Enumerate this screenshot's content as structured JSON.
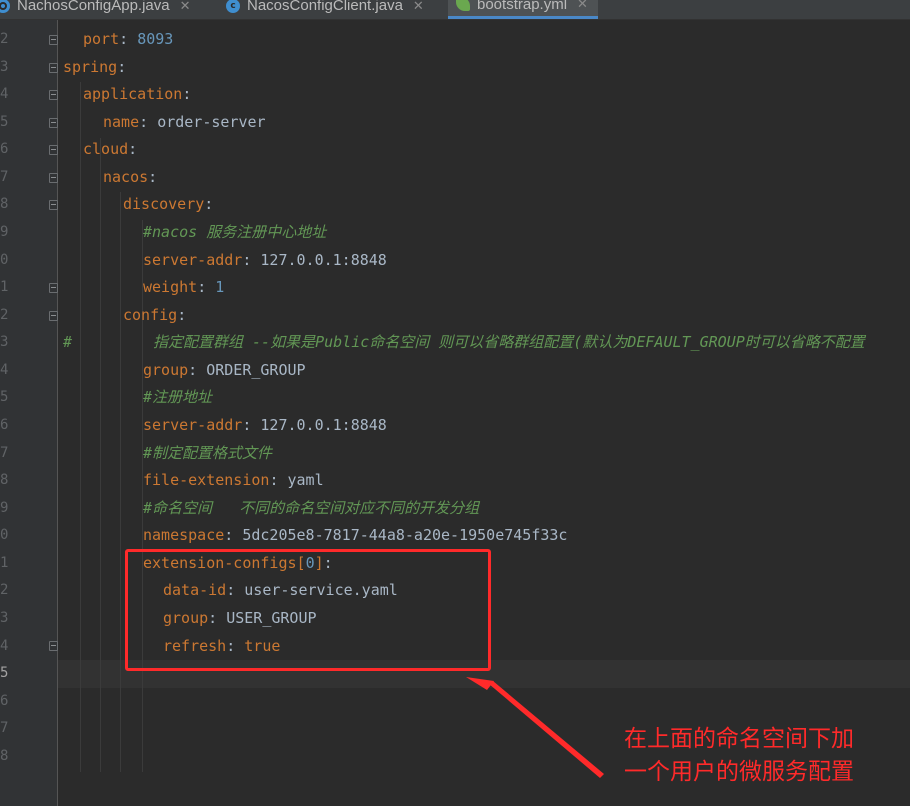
{
  "tabs": [
    {
      "label": "NachosConfigApp.java",
      "icon": "java-file-icon",
      "active": false
    },
    {
      "label": "NacosConfigClient.java",
      "icon": "java-class-icon",
      "active": false
    },
    {
      "label": "bootstrap.yml",
      "icon": "spring-leaf-icon",
      "active": true
    }
  ],
  "tab_close_symbol": "✕",
  "line_numbers": [
    "2",
    "3",
    "4",
    "5",
    "6",
    "7",
    "8",
    "9",
    "0",
    "1",
    "2",
    "3",
    "4",
    "5",
    "6",
    "7",
    "8",
    "9",
    "0",
    "1",
    "2",
    "3",
    "4",
    "5",
    "6",
    "7",
    "8"
  ],
  "code": {
    "l2_key": "port",
    "l2_val": "8093",
    "l3_key": "spring",
    "l4_key": "application",
    "l5_key": "name",
    "l5_val": "order-server",
    "l6_key": "cloud",
    "l7_key": "nacos",
    "l8_key": "discovery",
    "l9_comment": "#nacos 服务注册中心地址",
    "l10_key": "server-addr",
    "l10_val": "127.0.0.1:8848",
    "l11_key": "weight",
    "l11_val": "1",
    "l12_key": "config",
    "l13_hash": "#",
    "l13_comment": "指定配置群组 --如果是Public命名空间 则可以省略群组配置(默认为DEFAULT_GROUP时可以省略不配置",
    "l14_key": "group",
    "l14_val": "ORDER_GROUP",
    "l15_comment": "#注册地址",
    "l16_key": "server-addr",
    "l16_val": "127.0.0.1:8848",
    "l17_comment": "#制定配置格式文件",
    "l18_key": "file-extension",
    "l18_val": "yaml",
    "l19_comment": "#命名空间   不同的命名空间对应不同的开发分组",
    "l20_key": "namespace",
    "l20_val": "5dc205e8-7817-44a8-a20e-1950e745f33c",
    "l21_key": "extension-configs",
    "l21_open": "[",
    "l21_idx": "0",
    "l21_close": "]",
    "l22_key": "data-id",
    "l22_val": "user-service.yaml",
    "l23_key": "group",
    "l23_val": "USER_GROUP",
    "l24_key": "refresh",
    "l24_val": "true"
  },
  "annotation": {
    "text": "在上面的命名空间下加\n一个用户的微服务配置",
    "color": "#ff2a2a"
  }
}
